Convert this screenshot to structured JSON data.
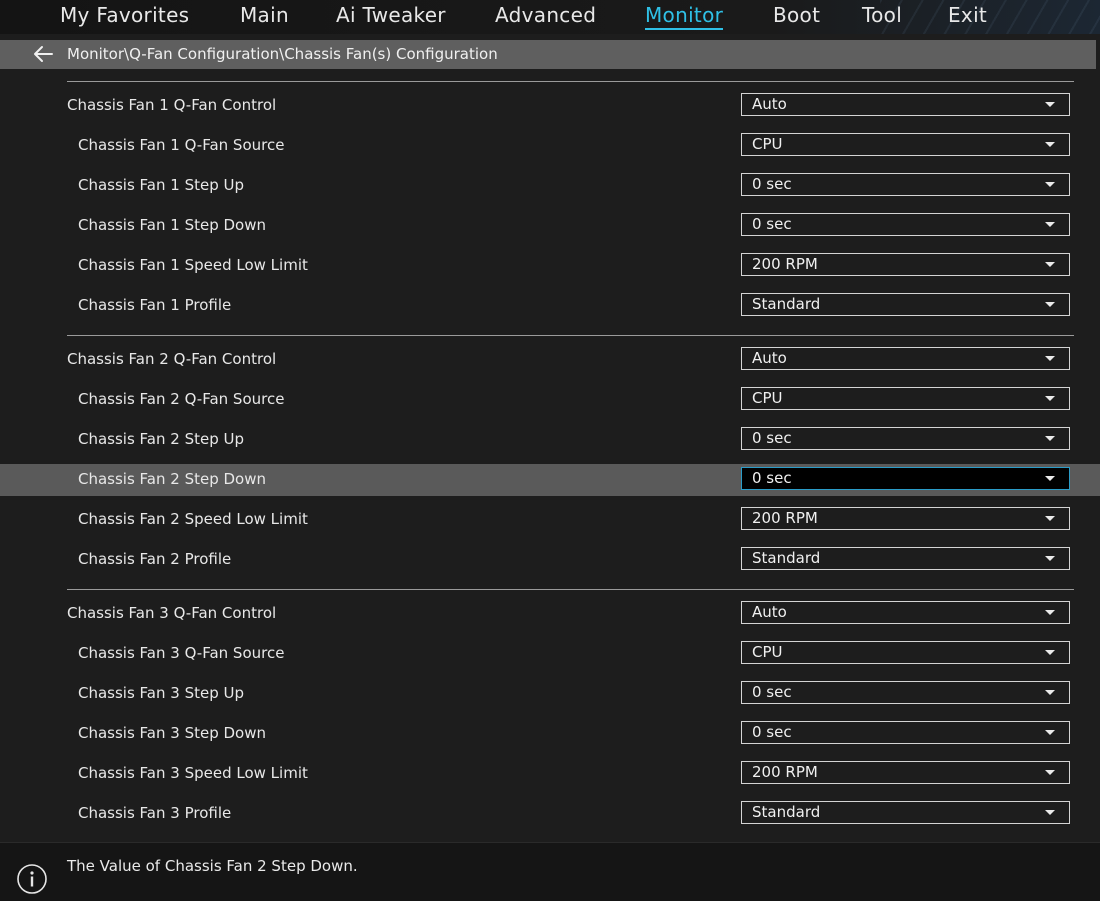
{
  "nav": {
    "tabs": [
      {
        "label": "My Favorites"
      },
      {
        "label": "Main"
      },
      {
        "label": "Ai Tweaker"
      },
      {
        "label": "Advanced"
      },
      {
        "label": "Monitor",
        "active": true
      },
      {
        "label": "Boot"
      },
      {
        "label": "Tool"
      },
      {
        "label": "Exit"
      }
    ]
  },
  "breadcrumb": {
    "path": "Monitor\\Q-Fan Configuration\\Chassis Fan(s) Configuration",
    "back_icon": "arrow-left-icon"
  },
  "groups": [
    {
      "rows": [
        {
          "label": "Chassis Fan 1 Q-Fan Control",
          "value": "Auto"
        },
        {
          "label": "Chassis Fan 1 Q-Fan Source",
          "value": "CPU"
        },
        {
          "label": "Chassis Fan 1 Step Up",
          "value": "0 sec"
        },
        {
          "label": "Chassis Fan 1 Step Down",
          "value": "0 sec"
        },
        {
          "label": "Chassis Fan 1 Speed Low Limit",
          "value": "200 RPM"
        },
        {
          "label": "Chassis Fan 1 Profile",
          "value": "Standard"
        }
      ]
    },
    {
      "rows": [
        {
          "label": "Chassis Fan 2 Q-Fan Control",
          "value": "Auto"
        },
        {
          "label": "Chassis Fan 2 Q-Fan Source",
          "value": "CPU"
        },
        {
          "label": "Chassis Fan 2 Step Up",
          "value": "0 sec"
        },
        {
          "label": "Chassis Fan 2 Step Down",
          "value": "0 sec",
          "selected": true
        },
        {
          "label": "Chassis Fan 2 Speed Low Limit",
          "value": "200 RPM"
        },
        {
          "label": "Chassis Fan 2 Profile",
          "value": "Standard"
        }
      ]
    },
    {
      "rows": [
        {
          "label": "Chassis Fan 3 Q-Fan Control",
          "value": "Auto"
        },
        {
          "label": "Chassis Fan 3 Q-Fan Source",
          "value": "CPU"
        },
        {
          "label": "Chassis Fan 3 Step Up",
          "value": "0 sec"
        },
        {
          "label": "Chassis Fan 3 Step Down",
          "value": "0 sec"
        },
        {
          "label": "Chassis Fan 3 Speed Low Limit",
          "value": "200 RPM"
        },
        {
          "label": "Chassis Fan 3 Profile",
          "value": "Standard"
        }
      ]
    }
  ],
  "help": {
    "text": "The Value of Chassis Fan 2 Step Down.",
    "icon": "info-icon"
  },
  "colors": {
    "accent": "#2fc0e6",
    "selected_row": "#5a5a5a",
    "focus_border": "#2a9cc8"
  }
}
